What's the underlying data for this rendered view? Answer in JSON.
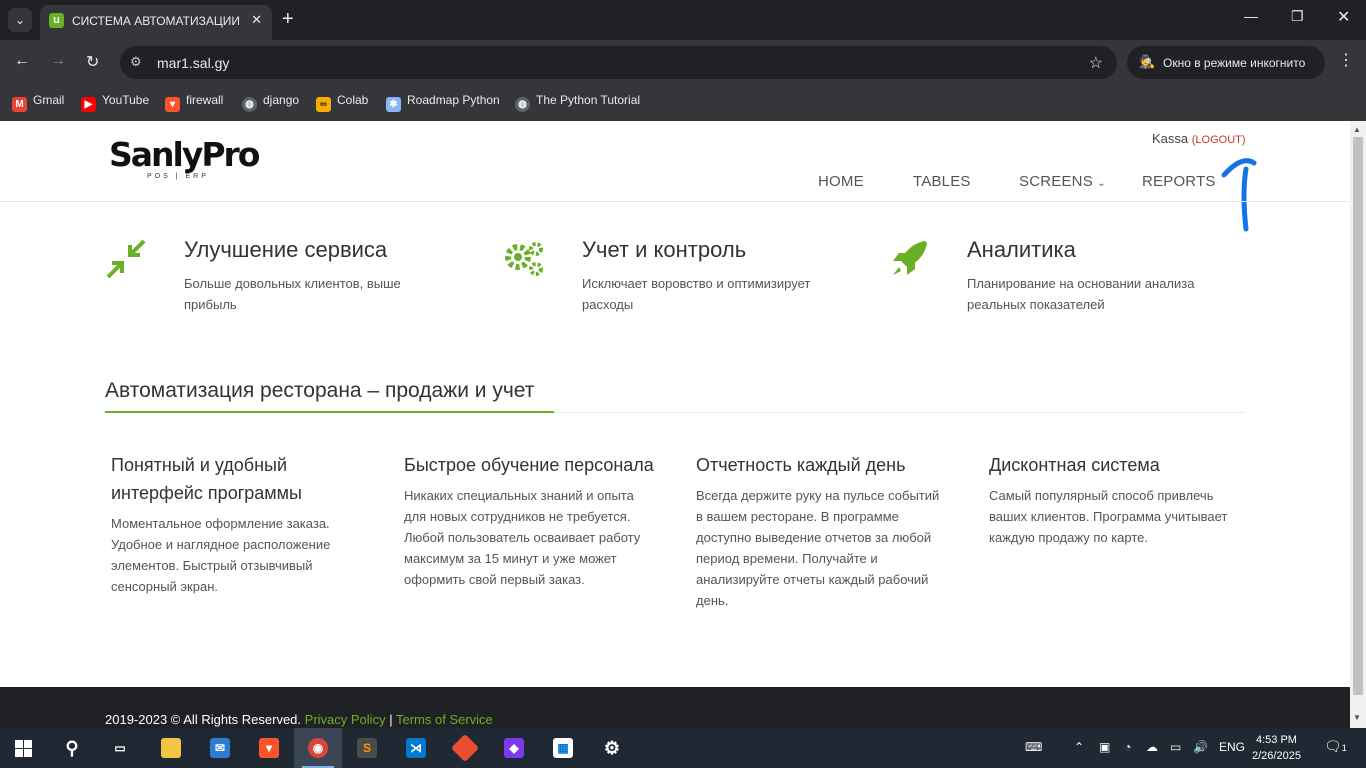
{
  "browser": {
    "tab_title": "СИСТЕМА АВТОМАТИЗАЦИИ",
    "url": "mar1.sal.gy",
    "incognito_label": "Окно в режиме инкогнито",
    "bookmarks": [
      {
        "label": "Gmail",
        "icon": "gmail-icon",
        "color": "#ea4335"
      },
      {
        "label": "YouTube",
        "icon": "youtube-icon",
        "color": "#ff0000"
      },
      {
        "label": "firewall",
        "icon": "brave-icon",
        "color": "#fb542b"
      },
      {
        "label": "django",
        "icon": "globe-icon",
        "color": "#9aa0a6"
      },
      {
        "label": "Colab",
        "icon": "colab-icon",
        "color": "#f9ab00"
      },
      {
        "label": "Roadmap Python",
        "icon": "roadmap-icon",
        "color": "#8ab4f8"
      },
      {
        "label": "The Python Tutorial",
        "icon": "globe-icon",
        "color": "#9aa0a6"
      }
    ]
  },
  "site": {
    "logo_text": "SanlyPro",
    "logo_sub": "POS | ERP",
    "user_name": "Kassa",
    "logout_label": "(LOGOUT)",
    "nav": [
      "HOME",
      "TABLES",
      "SCREENS",
      "REPORTS"
    ],
    "accent_color": "#6ab026",
    "features": [
      {
        "title": "Улучшение сервиса",
        "desc": "Больше довольных клиентов, выше прибыль",
        "icon": "compress-arrows-icon"
      },
      {
        "title": "Учет и контроль",
        "desc": "Исключает воровство и оптимизирует расходы",
        "icon": "gears-icon"
      },
      {
        "title": "Аналитика",
        "desc": "Планирование на основании анализа реальных показателей",
        "icon": "rocket-icon"
      }
    ],
    "section_title": "Автоматизация ресторана – продажи и учет",
    "columns": [
      {
        "title": "Понятный и удобный интерфейс программы",
        "desc": "Моментальное оформление заказа. Удобное и наглядное расположение элементов. Быстрый отзывчивый сенсорный экран."
      },
      {
        "title": "Быстрое обучение персонала",
        "desc": "Никаких специальных знаний и опыта для новых сотрудников не требуется. Любой пользователь осваивает работу максимум за 15 минут и уже может оформить свой первый заказ."
      },
      {
        "title": "Отчетность каждый день",
        "desc": "Всегда держите руку на пульсе событий в вашем ресторане. В программе доступно выведение отчетов за любой период времени. Получайте и анализируйте отчеты каждый рабочий день."
      },
      {
        "title": "Дисконтная система",
        "desc": "Самый популярный способ привлечь ваших клиентов. Программа учитывает каждую продажу по карте."
      }
    ],
    "footer": {
      "copyright": "2019-2023 © All Rights Reserved.",
      "privacy": "Privacy Policy",
      "separator": "|",
      "terms": "Terms of Service"
    }
  },
  "taskbar": {
    "language": "ENG",
    "time": "4:53 PM",
    "date": "2/26/2025",
    "notification_count": "1"
  }
}
